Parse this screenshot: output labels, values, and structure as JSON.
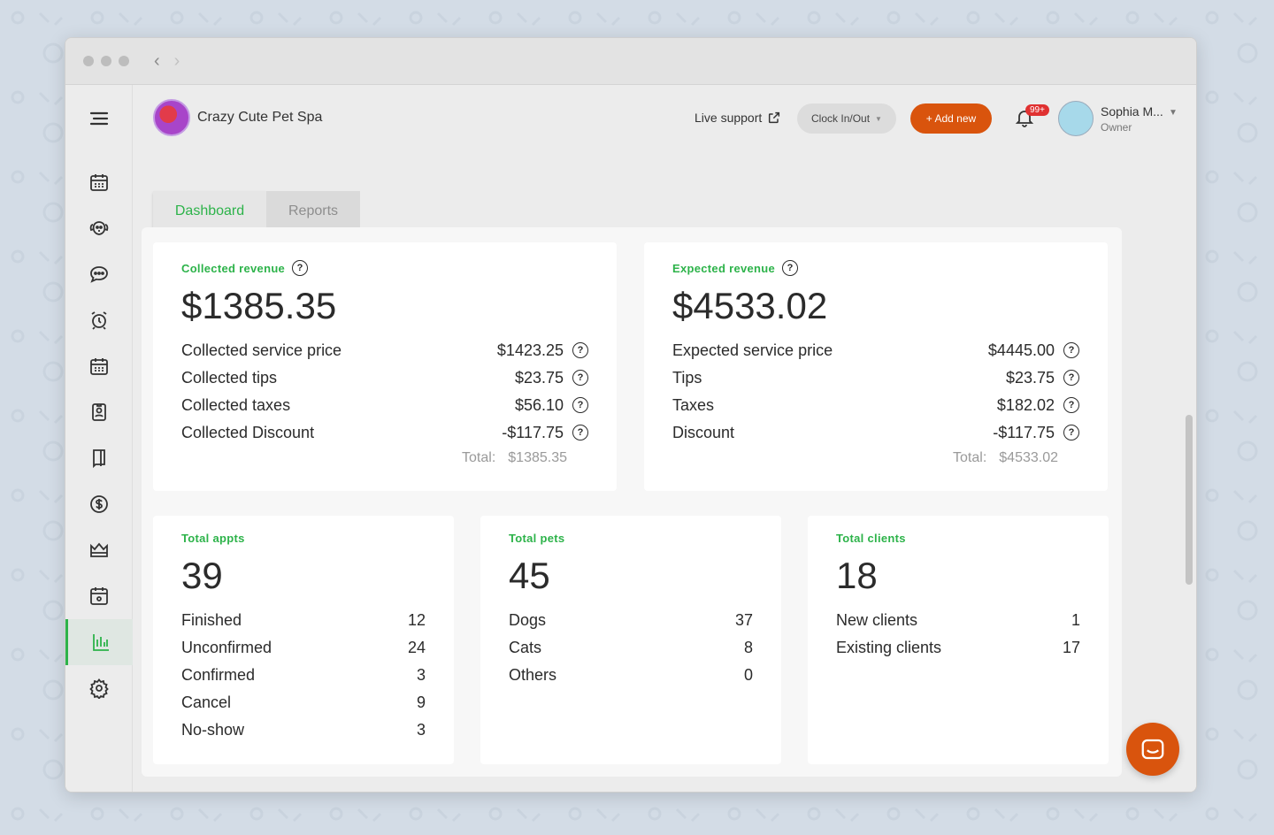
{
  "header": {
    "business_name": "Crazy Cute Pet Spa",
    "live_support": "Live support",
    "clock_button": "Clock In/Out",
    "add_button": "+ Add new",
    "notification_badge": "99+",
    "user_name": "Sophia M...",
    "user_role": "Owner"
  },
  "tabs": [
    "Dashboard",
    "Reports"
  ],
  "sidebar": {
    "items": [
      "menu-icon",
      "calendar-icon",
      "dog-icon",
      "chat-icon",
      "alarm-clock-icon",
      "schedule-icon",
      "contact-card-icon",
      "booklet-icon",
      "dollar-icon",
      "crown-icon",
      "calendar-star-icon",
      "chart-icon",
      "gear-icon"
    ],
    "active": "chart-icon"
  },
  "collected": {
    "title": "Collected revenue",
    "amount": "$1385.35",
    "rows": [
      {
        "label": "Collected service price",
        "value": "$1423.25"
      },
      {
        "label": "Collected tips",
        "value": "$23.75"
      },
      {
        "label": "Collected taxes",
        "value": "$56.10"
      },
      {
        "label": "Collected Discount",
        "value": "-$117.75"
      }
    ],
    "total_label": "Total:",
    "total_value": "$1385.35"
  },
  "expected": {
    "title": "Expected revenue",
    "amount": "$4533.02",
    "rows": [
      {
        "label": "Expected service price",
        "value": "$4445.00"
      },
      {
        "label": "Tips",
        "value": "$23.75"
      },
      {
        "label": "Taxes",
        "value": "$182.02"
      },
      {
        "label": "Discount",
        "value": "-$117.75"
      }
    ],
    "total_label": "Total:",
    "total_value": "$4533.02"
  },
  "appts": {
    "title": "Total appts",
    "count": "39",
    "rows": [
      {
        "label": "Finished",
        "value": "12"
      },
      {
        "label": "Unconfirmed",
        "value": "24"
      },
      {
        "label": "Confirmed",
        "value": "3"
      },
      {
        "label": "Cancel",
        "value": "9"
      },
      {
        "label": "No-show",
        "value": "3"
      }
    ]
  },
  "pets": {
    "title": "Total pets",
    "count": "45",
    "rows": [
      {
        "label": "Dogs",
        "value": "37"
      },
      {
        "label": "Cats",
        "value": "8"
      },
      {
        "label": "Others",
        "value": "0"
      }
    ]
  },
  "clients": {
    "title": "Total clients",
    "count": "18",
    "rows": [
      {
        "label": "New clients",
        "value": "1"
      },
      {
        "label": "Existing clients",
        "value": "17"
      }
    ]
  },
  "colors": {
    "accent_green": "#2db34a",
    "accent_orange": "#d9540d",
    "badge_red": "#e03131"
  }
}
